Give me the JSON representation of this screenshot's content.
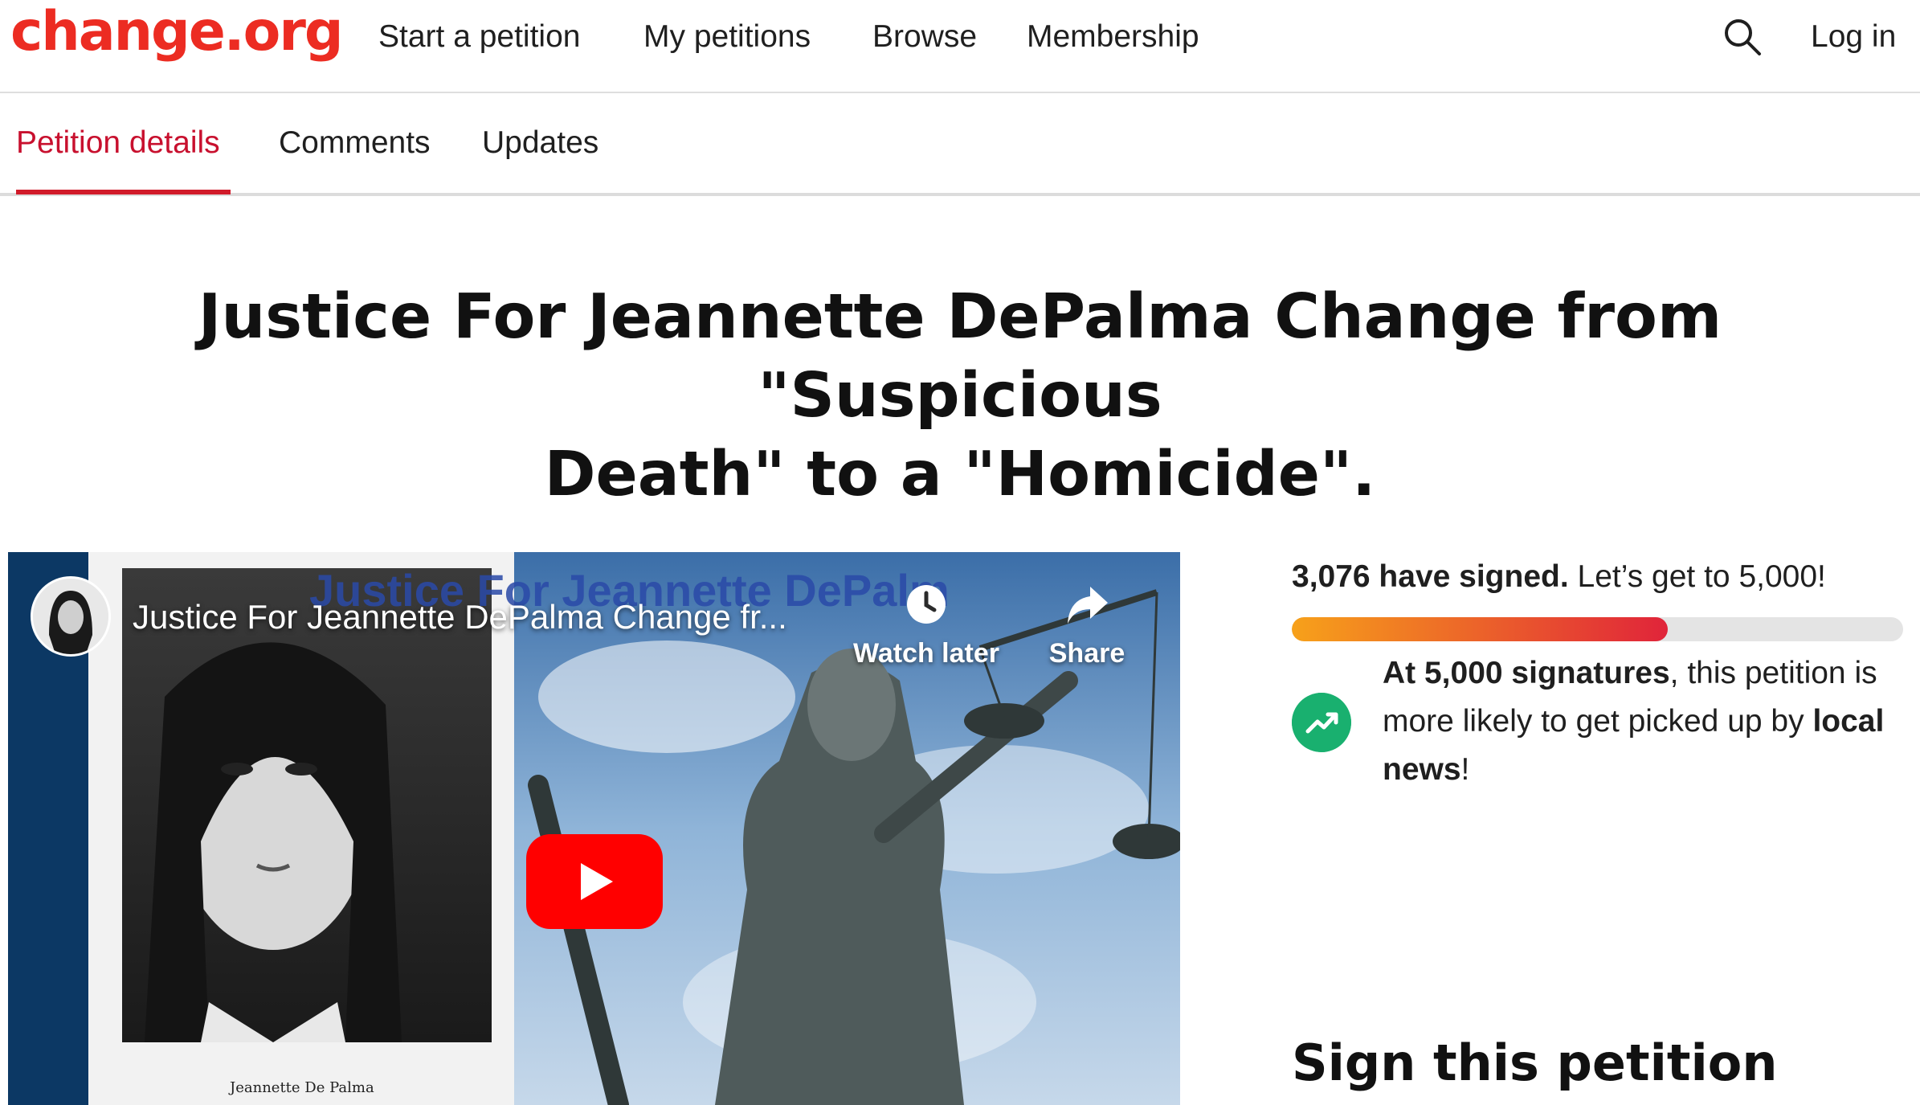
{
  "header": {
    "logo": "change.org",
    "nav": [
      "Start a petition",
      "My petitions",
      "Browse",
      "Membership"
    ],
    "search_icon": "search-icon",
    "login": "Log in"
  },
  "tabs": {
    "items": [
      "Petition details",
      "Comments",
      "Updates"
    ],
    "active": "Petition details"
  },
  "petition": {
    "title_line1": "Justice For Jeannette DePalma Change from \"Suspicious",
    "title_line2": "Death\" to a \"Homicide\"."
  },
  "video": {
    "title": "Justice For Jeannette DePalma Change fr...",
    "overlay_title": "Justice For Jeannette DePalm",
    "watch_later": "Watch later",
    "share": "Share",
    "caption": "Jeannette De Palma",
    "play_icon": "youtube-play-icon"
  },
  "signatures": {
    "count_label": "3,076 have signed.",
    "goal_label": "Let’s get to 5,000!",
    "signed": 3076,
    "goal": 5000,
    "milestone_bold": "At 5,000 signatures",
    "milestone_text": ", this petition is more likely to get picked up by ",
    "milestone_bold2": "local news",
    "milestone_end": "!"
  },
  "sign_section": {
    "title": "Sign this petition"
  },
  "colors": {
    "brand": "#ec2c22",
    "active_tab": "#c8102e",
    "progress_start": "#f7a11a",
    "progress_end": "#e0243a",
    "trend_green": "#19b06f"
  }
}
